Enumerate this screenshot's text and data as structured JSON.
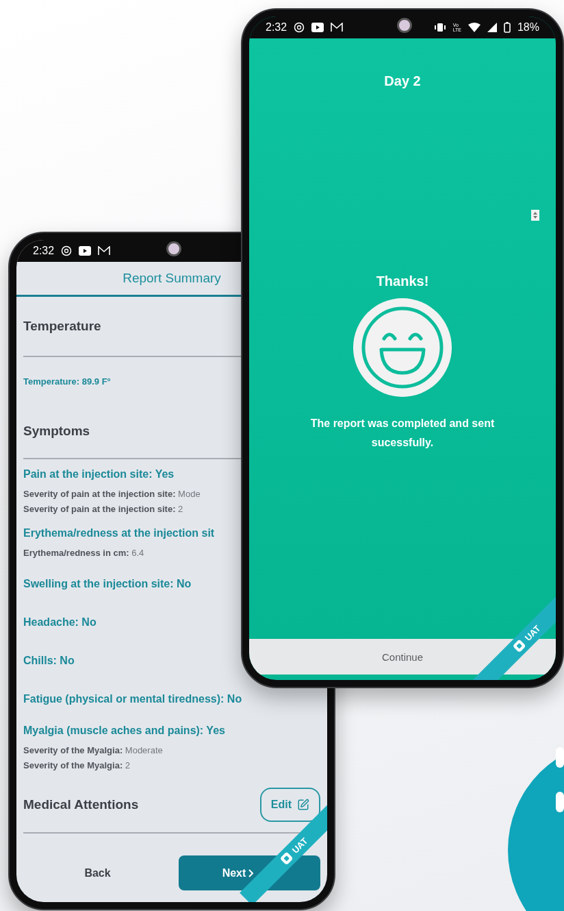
{
  "summary_phone": {
    "status_bar": {
      "time": "2:32"
    },
    "title": "Report Summary",
    "sections": [
      {
        "heading": "Temperature",
        "items": [
          {
            "kind": "reading",
            "title": "Temperature: 89.9 F°"
          }
        ]
      },
      {
        "heading": "Symptoms",
        "items": [
          {
            "kind": "answer",
            "title": "Pain at the injection site: Yes",
            "details": [
              "**Severity of pain at the injection site:** Mode",
              "**Severity of pain at the injection site:** 2"
            ]
          },
          {
            "kind": "answer",
            "title": "Erythema/redness at the injection sit",
            "details": [
              "**Erythema/redness in cm:** 6.4"
            ]
          },
          {
            "kind": "answer",
            "title": "Swelling at the injection site: No"
          },
          {
            "kind": "answer",
            "title": "Headache: No"
          },
          {
            "kind": "answer",
            "title": "Chills: No"
          },
          {
            "kind": "answer",
            "title": "Fatigue (physical or mental tiredness): No"
          },
          {
            "kind": "answer",
            "title": "Myalgia (muscle aches and pains): Yes",
            "details": [
              "**Severity of the Myalgia:** Moderate",
              "**Severity of the Myalgia:** 2"
            ]
          }
        ]
      },
      {
        "heading": "Medical Attentions",
        "edit_button": "Edit"
      }
    ],
    "back_button": "Back",
    "next_button": "Next",
    "ribbon": "UAT"
  },
  "thanks_phone": {
    "status_bar": {
      "time": "2:32",
      "network_label": {
        "line_1": "Vo",
        "line_2": "LTE"
      },
      "battery": "18%"
    },
    "title": "Day 2",
    "heading": "Thanks!",
    "message": "The report was completed and sent sucessfully.",
    "continue_button": "Continue",
    "ribbon": "UAT"
  }
}
